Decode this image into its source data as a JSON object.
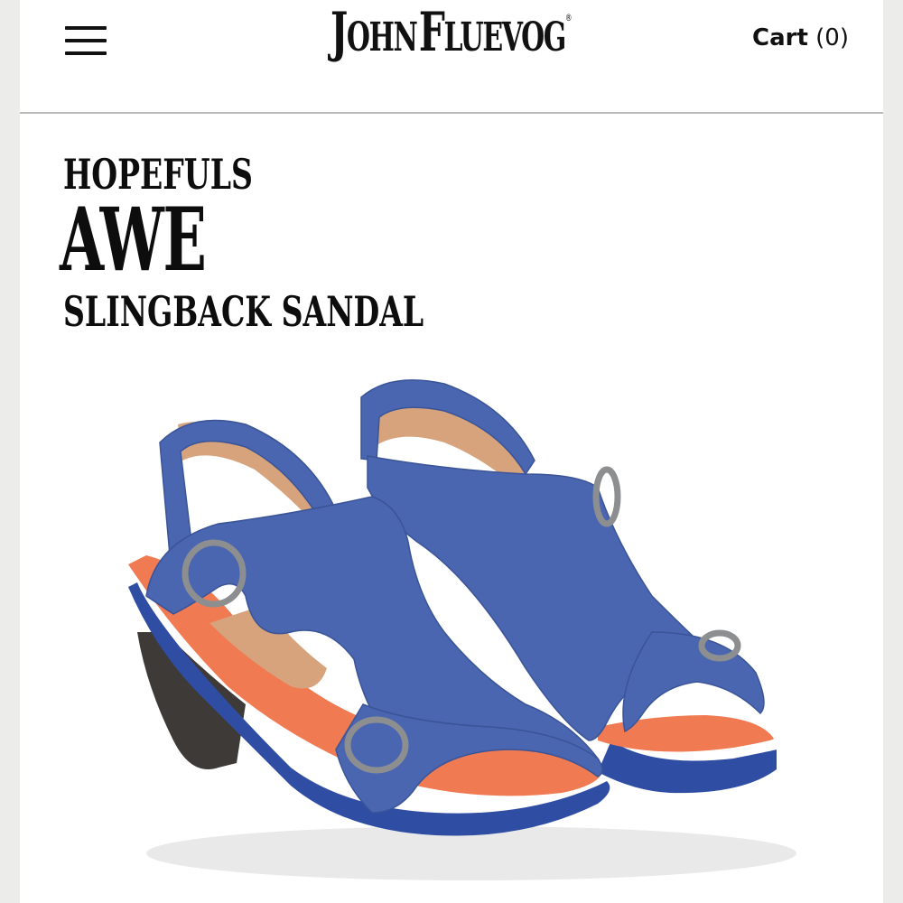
{
  "header": {
    "menu_icon": "hamburger-menu-icon",
    "logo": {
      "first_cap": "J",
      "first_rest": "OHN",
      "second_cap": "F",
      "second_rest": "LUEVOG",
      "registered": "®"
    },
    "cart": {
      "label": "Cart",
      "count": "(0)"
    }
  },
  "product": {
    "collection": "HOPEFULS",
    "name": "AWE",
    "subtitle": "SLINGBACK SANDAL",
    "image": {
      "colors": {
        "upper": "#4a66b0",
        "sole": "#2f4da3",
        "footbed": "#f07a52",
        "lining": "#d7a37c",
        "heel": "#3d3a38",
        "buckle": "#8d8e90"
      }
    }
  }
}
